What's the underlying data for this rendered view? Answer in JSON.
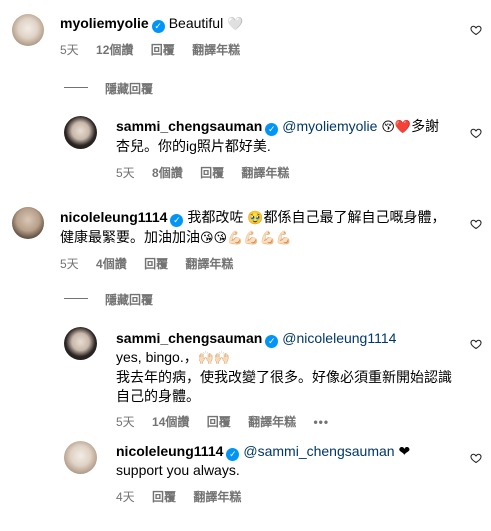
{
  "comments": [
    {
      "username": "myoliemyolie",
      "text": "Beautiful",
      "text_emoji": "🤍",
      "time": "5天",
      "likes": "12個讚",
      "reply": "回覆",
      "translate": "翻譯年糕"
    },
    {
      "username": "sammi_chengsauman",
      "mention": "@myoliemyolie",
      "text_emoji": "😚❤️",
      "text_line1_tail": "多謝",
      "text_line2": "杏兒。你的ig照片都好美.",
      "time": "5天",
      "likes": "8個讚",
      "reply": "回覆",
      "translate": "翻譯年糕"
    },
    {
      "username": "nicoleleung1114",
      "text_line1": "我都改咗",
      "text_emoji1": "🥹",
      "text_line1_tail": "都係自己最了解自己嘅身體，",
      "text_line2": "健康最緊要。加油加油",
      "text_emoji2": "😘😘💪🏻💪🏻💪🏻💪🏻",
      "time": "5天",
      "likes": "4個讚",
      "reply": "回覆",
      "translate": "翻譯年糕"
    },
    {
      "username": "sammi_chengsauman",
      "mention": "@nicoleleung1114",
      "text_line1": "yes, bingo.，",
      "text_emoji": "🙌🏻🙌🏻",
      "text_line2": "我去年的病，使我改變了很多。好像必須重新開始認識",
      "text_line3": "自己的身體。",
      "time": "5天",
      "likes": "14個讚",
      "reply": "回覆",
      "translate": "翻譯年糕",
      "more": "•••"
    },
    {
      "username": "nicoleleung1114",
      "mention": "@sammi_chengsauman",
      "text_emoji": "❤",
      "text_line2": "support you always.",
      "time": "4天",
      "reply": "回覆",
      "translate": "翻譯年糕"
    }
  ],
  "hide_replies_label": "隱藏回覆",
  "colors": {
    "verified": "#0095f6",
    "mention": "#00376b",
    "meta": "#737373"
  }
}
